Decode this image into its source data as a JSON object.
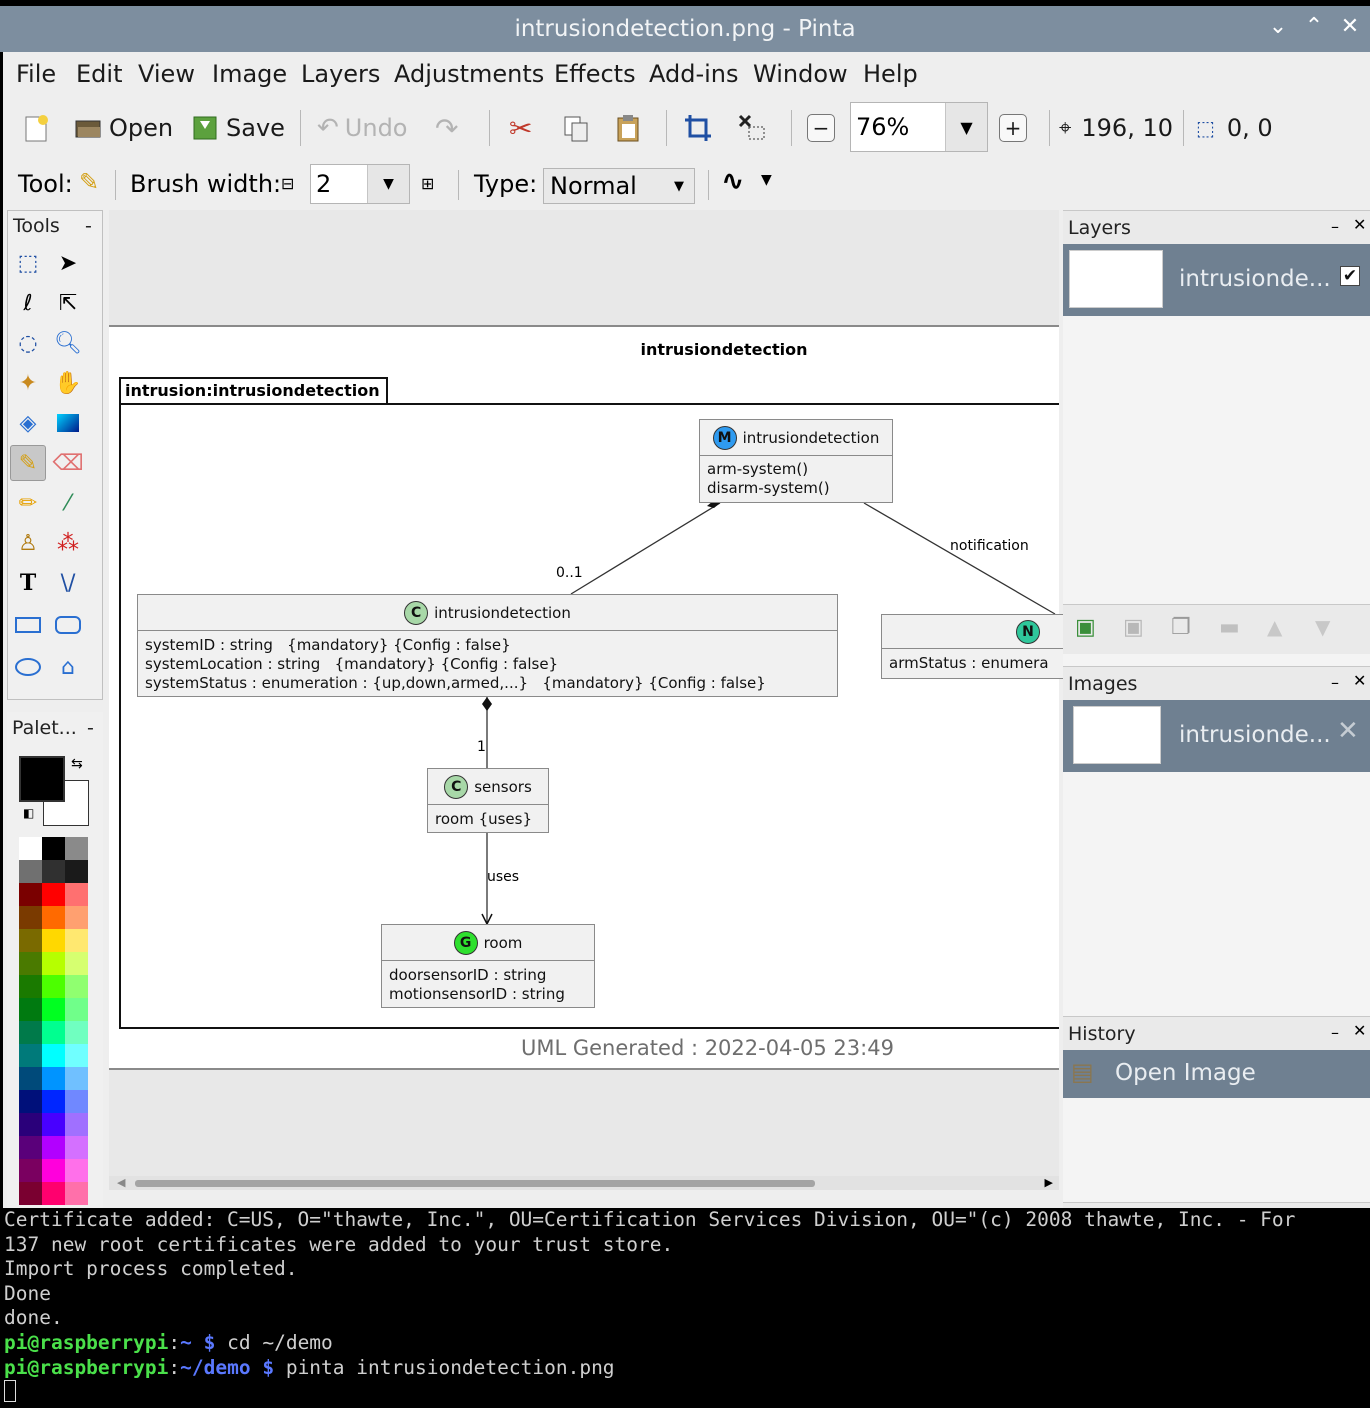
{
  "window": {
    "title": "intrusiondetection.png - Pinta",
    "controls": [
      "⌄",
      "⌃",
      "✕"
    ]
  },
  "menu": [
    "File",
    "Edit",
    "View",
    "Image",
    "Layers",
    "Adjustments",
    "Effects",
    "Add-ins",
    "Window",
    "Help"
  ],
  "toolbar": {
    "open_label": "Open",
    "save_label": "Save",
    "undo_label": "Undo",
    "zoom_value": "76%",
    "cursor_pos": "196, 10",
    "selection_size": "0, 0"
  },
  "options": {
    "tool_label": "Tool:",
    "brush_width_label": "Brush width:",
    "brush_width_value": "2",
    "type_label": "Type:",
    "type_value": "Normal"
  },
  "tools_panel": {
    "title": "Tools",
    "collapse": "-"
  },
  "palette_panel": {
    "title": "Palet...",
    "collapse": "-",
    "primary_color": "#000000",
    "secondary_color": "#ffffff"
  },
  "diagram": {
    "title": "intrusiondetection",
    "package_tab": "intrusion:intrusiondetection",
    "footer": "UML Generated : 2022-04-05 23:49",
    "module": {
      "stereotype": "M",
      "name": "intrusiondetection",
      "members": [
        "arm-system()",
        "disarm-system()"
      ]
    },
    "container": {
      "stereotype": "C",
      "name": "intrusiondetection",
      "members": [
        "systemID : string   {mandatory} {Config : false}",
        "systemLocation : string   {mandatory} {Config : false}",
        "systemStatus : enumeration : {up,down,armed,...}   {mandatory} {Config : false}"
      ]
    },
    "notification": {
      "stereotype": "N",
      "members": [
        "armStatus : enumera"
      ]
    },
    "sensors": {
      "stereotype": "C",
      "name": "sensors",
      "members": [
        "room {uses}"
      ]
    },
    "room": {
      "stereotype": "G",
      "name": "room",
      "members": [
        "doorsensorID : string",
        "motionsensorID : string"
      ]
    },
    "labels": {
      "mult_01": "0..1",
      "notification": "notification",
      "mult_1": "1",
      "uses": "uses"
    }
  },
  "layers_panel": {
    "title": "Layers",
    "layer_name": "intrusionde...",
    "visible": "✔"
  },
  "images_panel": {
    "title": "Images",
    "image_name": "intrusionde..."
  },
  "history_panel": {
    "title": "History",
    "item": "Open Image"
  },
  "terminal": {
    "lines": [
      "Certificate added: C=US, O=\"thawte, Inc.\", OU=Certification Services Division, OU=\"(c) 2008 thawte, Inc. - For",
      "137 new root certificates were added to your trust store.",
      "Import process completed.",
      "Done",
      "done."
    ],
    "prompt1": {
      "user": "pi@raspberrypi",
      "path": "~",
      "cmd": "cd ~/demo"
    },
    "prompt2": {
      "user": "pi@raspberrypi",
      "path": "~/demo",
      "cmd": "pinta intrusiondetection.png"
    }
  }
}
